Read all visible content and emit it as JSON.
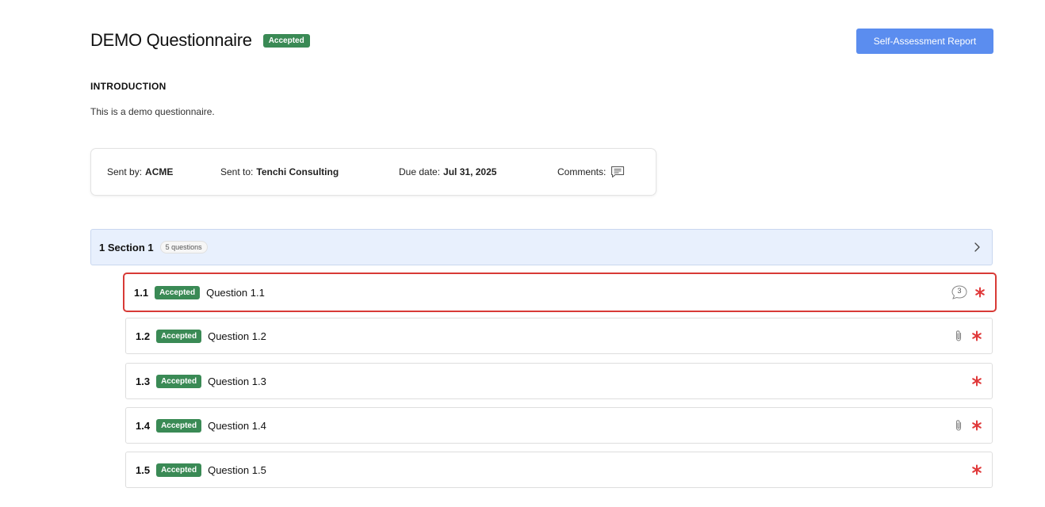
{
  "header": {
    "title": "DEMO Questionnaire",
    "status": "Accepted",
    "report_button_label": "Self-Assessment Report"
  },
  "introduction": {
    "heading": "INTRODUCTION",
    "text": "This is a demo questionnaire."
  },
  "info": {
    "sent_by_label": "Sent by:",
    "sent_by_value": "ACME",
    "sent_to_label": "Sent to:",
    "sent_to_value": "Tenchi Consulting",
    "due_date_label": "Due date:",
    "due_date_value": "Jul 31, 2025",
    "comments_label": "Comments:",
    "comments_icon": "comment-lines-icon"
  },
  "section": {
    "title": "1 Section 1",
    "count": "5 questions",
    "chevron_icon": "chevron-right-icon"
  },
  "questions": [
    {
      "number": "1.1",
      "status": "Accepted",
      "title": "Question 1.1",
      "comment_count": "3",
      "has_attachment": false,
      "required": true
    },
    {
      "number": "1.2",
      "status": "Accepted",
      "title": "Question 1.2",
      "comment_count": null,
      "has_attachment": true,
      "required": true
    },
    {
      "number": "1.3",
      "status": "Accepted",
      "title": "Question 1.3",
      "comment_count": null,
      "has_attachment": false,
      "required": true
    },
    {
      "number": "1.4",
      "status": "Accepted",
      "title": "Question 1.4",
      "comment_count": null,
      "has_attachment": true,
      "required": true
    },
    {
      "number": "1.5",
      "status": "Accepted",
      "title": "Question 1.5",
      "comment_count": null,
      "has_attachment": false,
      "required": true
    }
  ],
  "colors": {
    "accepted_badge": "#3a8a55",
    "primary_button": "#5b8def",
    "section_bg": "#e8f0fd",
    "selected_border": "#d83a36",
    "required_asterisk": "#e0393a"
  }
}
